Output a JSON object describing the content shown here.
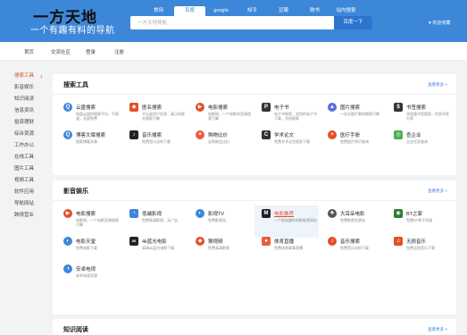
{
  "header": {
    "logo_main": "一方天地",
    "logo_sub": "一个有趣有料的导航",
    "search_tabs": [
      "常用",
      "百度",
      "google",
      "知乎",
      "豆瓣",
      "购书",
      "站内搜索"
    ],
    "active_tab": 1,
    "search_placeholder": "一方天地导航",
    "search_button": "百度一下",
    "welcome": "♥ 欢迎收藏"
  },
  "nav": {
    "items": [
      "首页",
      "交流社区",
      "登录",
      "注册"
    ]
  },
  "sidebar": {
    "items": [
      "搜索工具",
      "影音娱乐",
      "知识阅读",
      "信息资讯",
      "投资理财",
      "综合资源",
      "工作办公",
      "在线工具",
      "图片工具",
      "视频工具",
      "软件应用",
      "导航网站",
      "跨境营业"
    ],
    "active": 0
  },
  "sections": [
    {
      "title": "搜索工具",
      "more": "查看更多 >",
      "items": [
        {
          "name": "云盘搜索",
          "desc": "网盘云盘的搜索平台，不限速，全部免费",
          "icon": "cloud-search-icon",
          "color": "#3d87d9",
          "glyph": "Q"
        },
        {
          "name": "匿名搜索",
          "desc": "不记录用户信息，真正的匿名搜索引擎",
          "icon": "shield-icon",
          "color": "#e2502a",
          "glyph": "◆"
        },
        {
          "name": "电影搜索",
          "desc": "电影网，一个电影的资源搜索引擎",
          "icon": "film-icon",
          "color": "#e2502a",
          "glyph": "▶"
        },
        {
          "name": "电子书",
          "desc": "电子书搜索，实用的电子书下载，文档搜索",
          "icon": "book-icon",
          "color": "#333333",
          "glyph": "P"
        },
        {
          "name": "图片搜索",
          "desc": "一站式图片素材搜索引擎",
          "icon": "image-icon",
          "color": "#5b6fd6",
          "glyph": "▲"
        },
        {
          "name": "书签搜索",
          "desc": "浏览器书签搜索，优质书签分享",
          "icon": "bookmark-icon",
          "color": "#333333",
          "glyph": "$"
        },
        {
          "name": "博客文章搜索",
          "desc": "搜索博客文章",
          "icon": "article-search-icon",
          "color": "#3d87d9",
          "glyph": "Q"
        },
        {
          "name": "音乐搜索",
          "desc": "免费音乐试听下载",
          "icon": "music-icon",
          "color": "#222222",
          "glyph": "♪"
        },
        {
          "name": "购物比价",
          "desc": "全网商品比价",
          "icon": "shopping-icon",
          "color": "#ea5d3f",
          "glyph": "✦"
        },
        {
          "name": "学术论文",
          "desc": "免费学术论文搜索下载",
          "icon": "paper-icon",
          "color": "#333333",
          "glyph": "C"
        },
        {
          "name": "医疗手册",
          "desc": "免费医疗知识查询",
          "icon": "medical-icon",
          "color": "#e2502a",
          "glyph": "+"
        },
        {
          "name": "查企业",
          "desc": "企业信息查询",
          "icon": "company-icon",
          "color": "#4caf50",
          "glyph": "◎"
        }
      ]
    },
    {
      "title": "影音娱乐",
      "more": "查看更多 >",
      "items": [
        {
          "name": "电影搜索",
          "desc": "电影网，一个电影资源搜索引擎",
          "icon": "film-icon",
          "color": "#e2502a",
          "glyph": "▶"
        },
        {
          "name": "低端影视",
          "desc": "免费高清影视，无广告",
          "icon": "video-icon",
          "color": "#3d87d9",
          "glyph": "◔"
        },
        {
          "name": "影视TV",
          "desc": "免费影视站",
          "icon": "tv-icon",
          "color": "#3d87d9",
          "glyph": "◐"
        },
        {
          "name": "电影推荐",
          "desc": "一个很有趣的电影推荐网站",
          "icon": "m-logo-icon",
          "color": "#222222",
          "glyph": "M"
        },
        {
          "name": "大耳朵电影",
          "desc": "免费影视资源站",
          "icon": "ear-icon",
          "color": "#555555",
          "glyph": "❖"
        },
        {
          "name": "BT之家",
          "desc": "免费BT种子资源",
          "icon": "bt-icon",
          "color": "#2e7d32",
          "glyph": "◉"
        },
        {
          "name": "电影天堂",
          "desc": "免费电影下载",
          "icon": "movie-heaven-icon",
          "color": "#3d87d9",
          "glyph": "◐"
        },
        {
          "name": "4k蓝光电影",
          "desc": "高清4k蓝光电影下载",
          "icon": "4k-icon",
          "color": "#222222",
          "glyph": "4K"
        },
        {
          "name": "猴视频",
          "desc": "免费高清影视",
          "icon": "monkey-icon",
          "color": "#e2502a",
          "glyph": "◆"
        },
        {
          "name": "体育直播",
          "desc": "免费体育赛事直播",
          "icon": "sports-icon",
          "color": "#ea5d3f",
          "glyph": "●"
        },
        {
          "name": "音乐搜索",
          "desc": "免费音乐试听下载",
          "icon": "music-icon",
          "color": "#e2502a",
          "glyph": "♪"
        },
        {
          "name": "无损音乐",
          "desc": "免费无损音乐下载",
          "icon": "lossless-music-icon",
          "color": "#e2502a",
          "glyph": "♫"
        },
        {
          "name": "安卓电视",
          "desc": "安卓电视资源",
          "icon": "android-tv-icon",
          "color": "#3d87d9",
          "glyph": "◑"
        }
      ]
    },
    {
      "title": "知识阅读",
      "more": "查看更多 >",
      "items": []
    }
  ]
}
